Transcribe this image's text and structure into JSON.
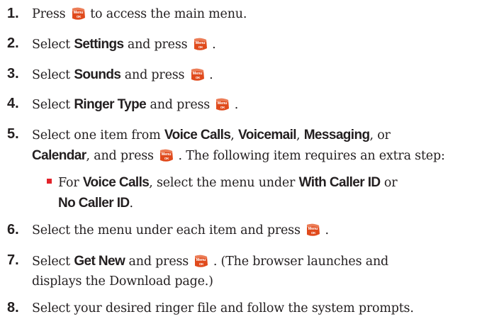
{
  "key_icon": {
    "name": "menu-ok-key-icon",
    "label_top": "Menu",
    "label_bottom": "OK",
    "color": "#e04a1c"
  },
  "bullet_color": "#e2232a",
  "steps": [
    {
      "num": "1.",
      "pre": "Press",
      "post": "to access the main menu."
    },
    {
      "num": "2.",
      "pre": "Select",
      "bold": "Settings",
      "mid": "and press",
      "post": "."
    },
    {
      "num": "3.",
      "pre": "Select",
      "bold": "Sounds",
      "mid": "and press",
      "post": "."
    },
    {
      "num": "4.",
      "pre": "Select",
      "bold": "Ringer Type",
      "mid": "and press",
      "post": "."
    },
    {
      "num": "5.",
      "line1": {
        "pre": "Select one item from",
        "b1": "Voice Calls",
        "s1": ",",
        "b2": "Voicemail",
        "s2": ",",
        "b3": "Messaging",
        "s3": ", or"
      },
      "line2": {
        "b1": "Calendar",
        "mid": ", and press",
        "post": ". The following item requires an extra step:"
      },
      "sub": {
        "pre": "For",
        "b1": "Voice Calls",
        "mid": ", select the menu under",
        "b2": "With Caller ID",
        "or": "or",
        "b3": "No Caller ID",
        "post": "."
      }
    },
    {
      "num": "6.",
      "pre": "Select the menu under each item and press",
      "post": "."
    },
    {
      "num": "7.",
      "pre": "Select",
      "bold": "Get New",
      "mid": "and press",
      "post": ". (The browser launches and",
      "line2": "displays the Download page.)"
    },
    {
      "num": "8.",
      "pre": "Select your desired ringer file and follow the system prompts."
    }
  ]
}
